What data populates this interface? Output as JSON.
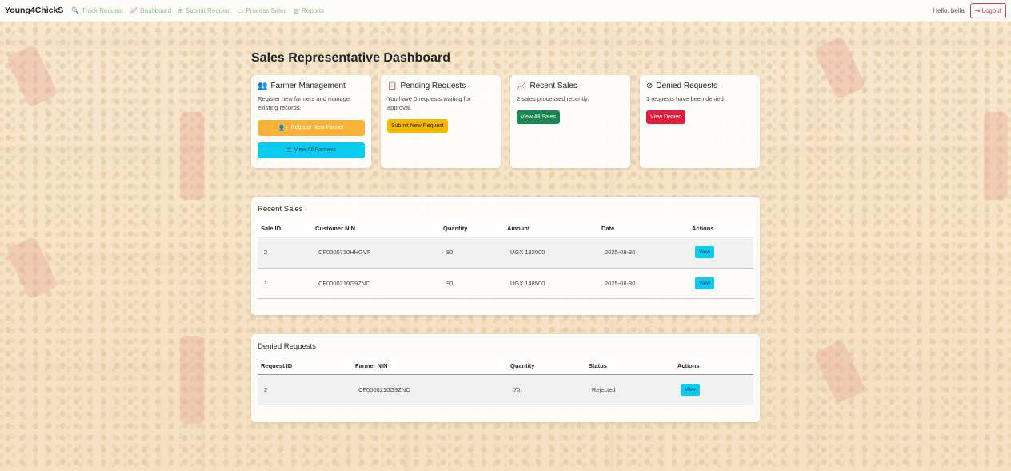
{
  "nav": {
    "brand": "Young4ChickS",
    "links": [
      {
        "icon": "search-icon",
        "glyph": "🔍",
        "label": "Track Request"
      },
      {
        "icon": "chart-line-icon",
        "glyph": "📈",
        "label": "Dashboard"
      },
      {
        "icon": "plus-circle-icon",
        "glyph": "⊕",
        "label": "Submit Request"
      },
      {
        "icon": "money-bill-icon",
        "glyph": "▭",
        "label": "Process Sales"
      },
      {
        "icon": "chart-bar-icon",
        "glyph": "▥",
        "label": "Reports"
      }
    ],
    "greeting": "Hello, bella",
    "logout": "Logout"
  },
  "page_title": "Sales Representative Dashboard",
  "cards": {
    "farmer": {
      "title": "Farmer Management",
      "text": "Register new farmers and manage existing records.",
      "btn1": "Register New Farmer",
      "btn2": "View All Farmers"
    },
    "pending": {
      "title": "Pending Requests",
      "text": "You have 0 requests waiting for approval.",
      "btn": "Submit New Request"
    },
    "recent": {
      "title": "Recent Sales",
      "text": "2 sales processed recently.",
      "btn": "View All Sales"
    },
    "denied": {
      "title": "Denied Requests",
      "text": "1 requests have been denied.",
      "btn": "View Denied"
    }
  },
  "recent_sales": {
    "title": "Recent Sales",
    "headers": [
      "Sale ID",
      "Customer NIN",
      "Quantity",
      "Amount",
      "Date",
      "Actions"
    ],
    "rows": [
      {
        "id": "2",
        "nin": "CF0000710HHGVF",
        "qty": "80",
        "amount": "UGX 132000",
        "date": "2025-08-30",
        "action": "View"
      },
      {
        "id": "1",
        "nin": "CF0000210G9ZNC",
        "qty": "90",
        "amount": "UGX 148500",
        "date": "2025-08-30",
        "action": "View"
      }
    ]
  },
  "denied_requests": {
    "title": "Denied Requests",
    "headers": [
      "Request ID",
      "Farmer NIN",
      "Quantity",
      "Status",
      "Actions"
    ],
    "rows": [
      {
        "id": "2",
        "nin": "CF0000210G9ZNC",
        "qty": "70",
        "status": "Rejected",
        "action": "View"
      }
    ]
  },
  "colors": {
    "brand_green": "#8fbf8f",
    "danger": "#dc3545",
    "info": "#0dcaf0",
    "success": "#198754",
    "warning": "#f7b800",
    "orange": "#f8b23a"
  }
}
